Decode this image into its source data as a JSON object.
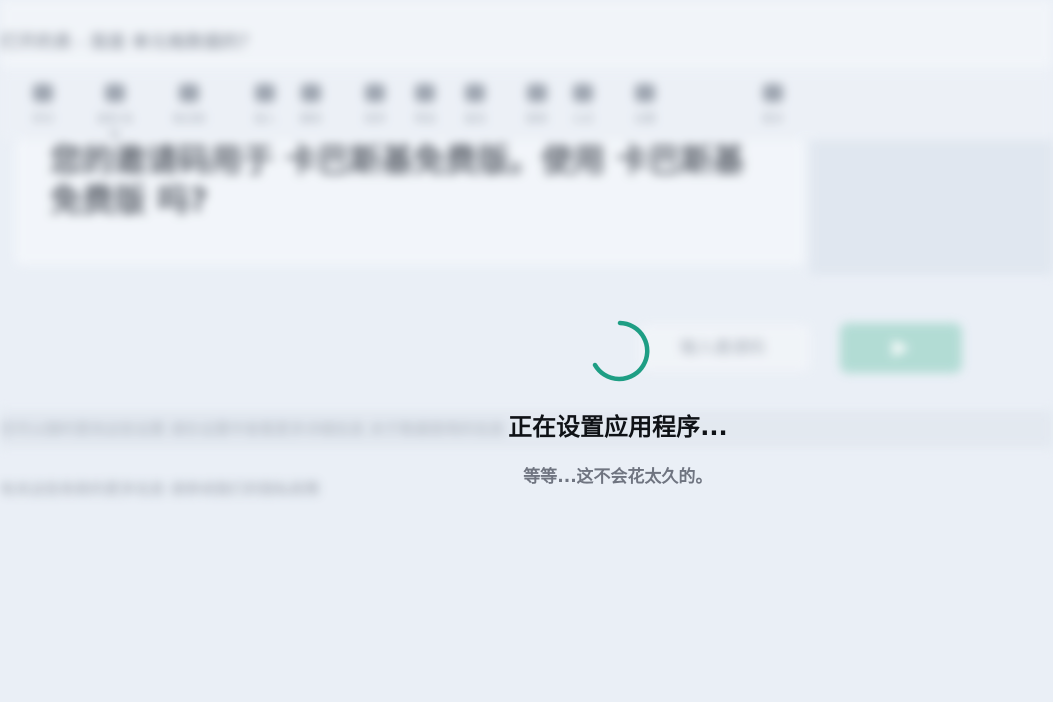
{
  "background": {
    "window_title": "打开的表 - 我是 单元格数据的？",
    "ribbon_items": [
      {
        "label": "剪切",
        "icon": "cut-icon"
      },
      {
        "label": "复制 粘贴",
        "icon": "paste-icon"
      },
      {
        "label": "格式刷",
        "icon": "format-painter-icon"
      },
      {
        "label": "插入",
        "icon": "insert-icon"
      },
      {
        "label": "删除",
        "icon": "delete-icon"
      },
      {
        "label": "排序",
        "icon": "sort-icon"
      },
      {
        "label": "筛选",
        "icon": "filter-icon"
      },
      {
        "label": "查找",
        "icon": "find-icon"
      },
      {
        "label": "图表",
        "icon": "chart-icon"
      },
      {
        "label": "公式",
        "icon": "formula-icon"
      },
      {
        "label": "设置",
        "icon": "settings-icon"
      },
      {
        "label": "更多",
        "icon": "more-icon"
      }
    ],
    "question_text": "您的邀请码用于 卡巴斯基免费版。使用 卡巴斯基免费版 吗?",
    "input_placeholder": "输入邀请码",
    "go_button_label": "▶",
    "band_text": "您可以随时更改这些设置 请在设置中查看更多详细信息 关于数据使用的信息",
    "info_text": "有关这些条款的更多信息 请参阅我们的隐私政策"
  },
  "overlay": {
    "spinner_icon": "loading-spinner-icon",
    "accent_color": "#1e9e84",
    "title": "正在设置应用程序...",
    "subtitle": "等等...这不会花太久的。"
  }
}
